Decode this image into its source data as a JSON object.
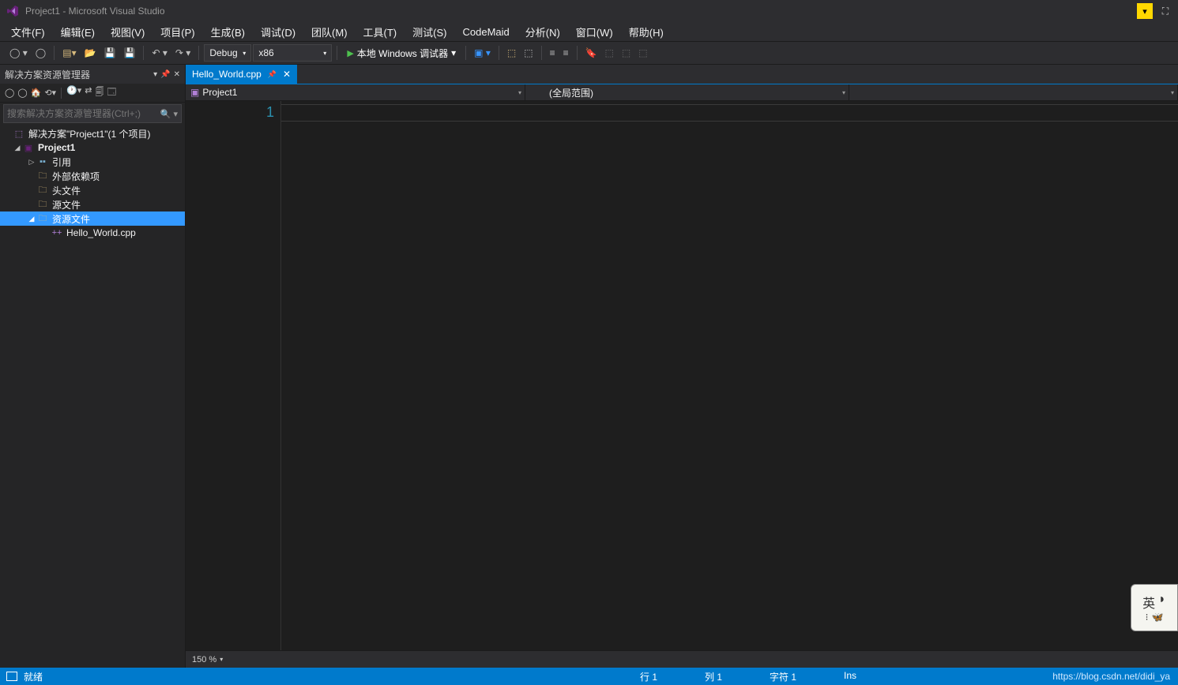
{
  "title": "Project1 - Microsoft Visual Studio",
  "menu": {
    "file": "文件(F)",
    "edit": "编辑(E)",
    "view": "视图(V)",
    "project": "项目(P)",
    "build": "生成(B)",
    "debug": "调试(D)",
    "team": "团队(M)",
    "tools": "工具(T)",
    "test": "测试(S)",
    "codemaid": "CodeMaid",
    "analyze": "分析(N)",
    "window": "窗口(W)",
    "help": "帮助(H)"
  },
  "toolbar": {
    "config": "Debug",
    "platform": "x86",
    "run": "本地 Windows 调试器"
  },
  "sidepanel": {
    "title": "解决方案资源管理器",
    "search_placeholder": "搜索解决方案资源管理器(Ctrl+;)",
    "solution": "解决方案\"Project1\"(1 个项目)",
    "project": "Project1",
    "nodes": {
      "refs": "引用",
      "ext": "外部依赖项",
      "hdr": "头文件",
      "src": "源文件",
      "res": "资源文件",
      "file": "Hello_World.cpp"
    }
  },
  "editor": {
    "tab": "Hello_World.cpp",
    "nav_project": "Project1",
    "nav_scope": "(全局范围)",
    "line_no": "1",
    "zoom": "150 %"
  },
  "status": {
    "ready": "就绪",
    "line": "行 1",
    "col": "列 1",
    "char": "字符 1",
    "ins": "Ins",
    "url": "https://blog.csdn.net/didi_ya"
  },
  "ime": {
    "t": "英",
    "b1": "⁝",
    "b2": "✕"
  }
}
